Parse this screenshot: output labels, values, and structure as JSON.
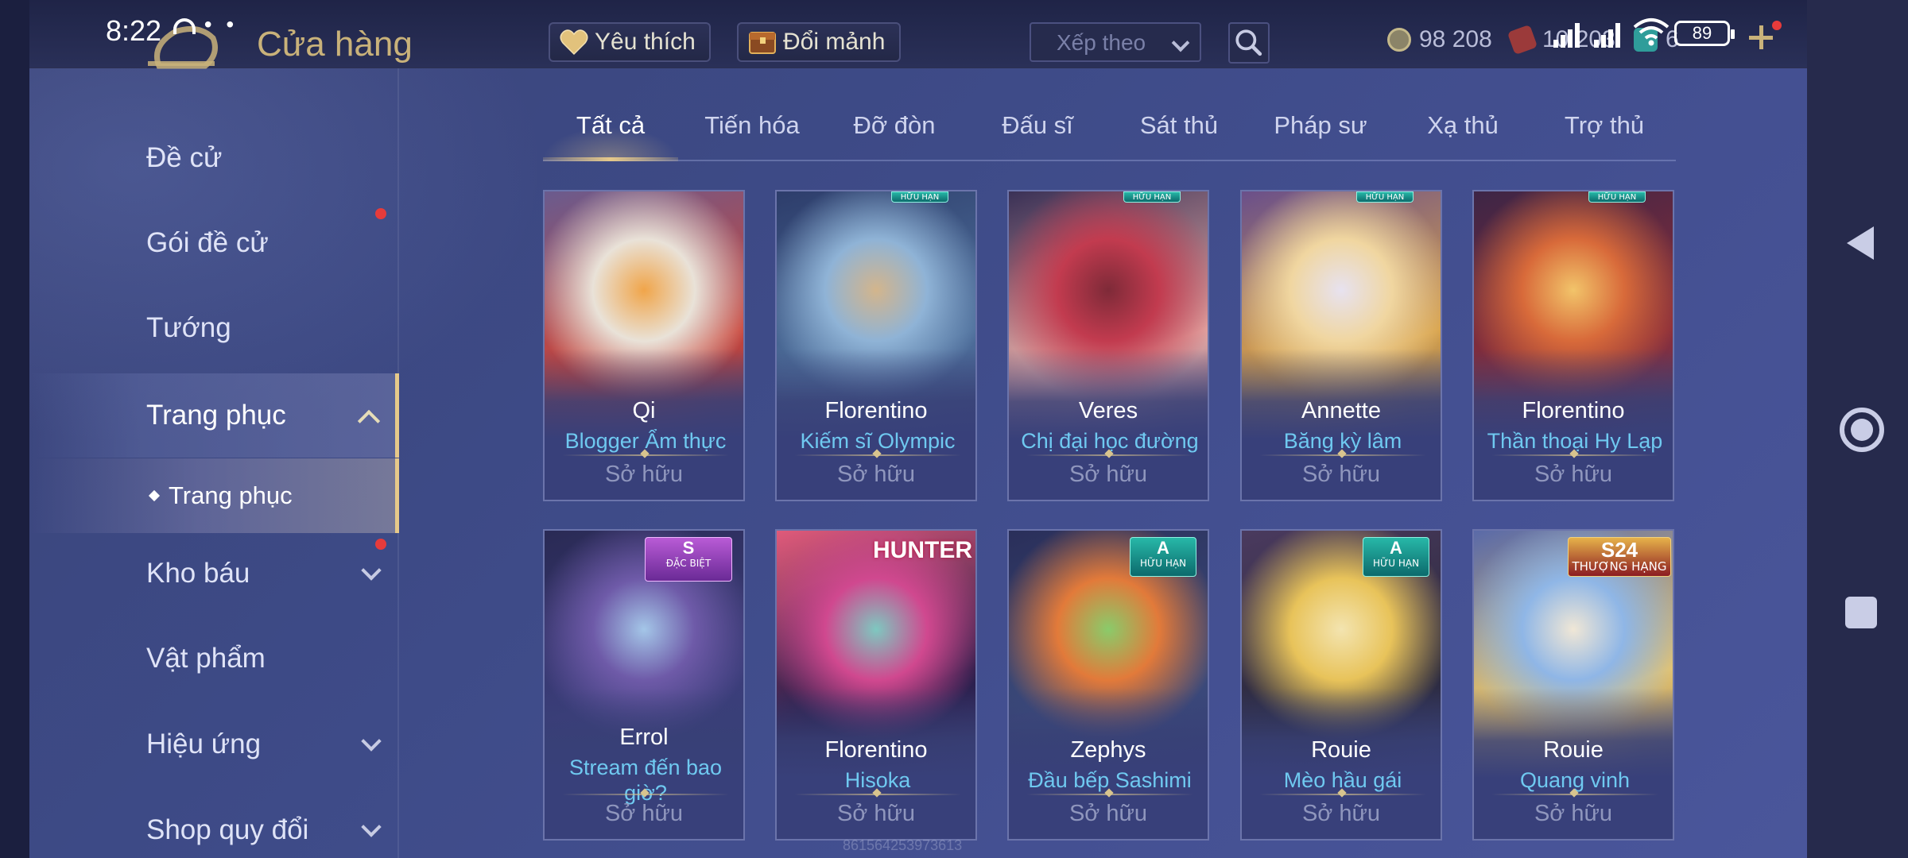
{
  "status": {
    "time": "8:22",
    "battery": "89"
  },
  "header": {
    "title": "Cửa hàng",
    "favorites_label": "Yêu thích",
    "shard_exchange_label": "Đổi mảnh",
    "sort_placeholder": "Xếp theo",
    "currency_gold": "98 208",
    "currency_red": "10 203",
    "currency_blue": "6"
  },
  "sidebar": {
    "items": [
      {
        "label": "Đề cử",
        "has_dot": false,
        "chevron": "none"
      },
      {
        "label": "Gói đề cử",
        "has_dot": true,
        "chevron": "none"
      },
      {
        "label": "Tướng",
        "has_dot": false,
        "chevron": "none"
      },
      {
        "label": "Trang phục",
        "has_dot": false,
        "chevron": "up",
        "active": true
      },
      {
        "label": "Kho báu",
        "has_dot": true,
        "chevron": "down"
      },
      {
        "label": "Vật phẩm",
        "has_dot": false,
        "chevron": "none"
      },
      {
        "label": "Hiệu ứng",
        "has_dot": false,
        "chevron": "down"
      },
      {
        "label": "Shop quy đổi",
        "has_dot": false,
        "chevron": "down"
      }
    ],
    "subitem": "Trang phục"
  },
  "tabs": [
    "Tất cả",
    "Tiến hóa",
    "Đỡ đòn",
    "Đấu sĩ",
    "Sát thủ",
    "Pháp sư",
    "Xạ thủ",
    "Trợ thủ"
  ],
  "cards": [
    {
      "hero": "Qi",
      "skin": "Blogger Ẩm thực",
      "status": "Sở hữu",
      "tag": ""
    },
    {
      "hero": "Florentino",
      "skin": "Kiếm sĩ Olympic",
      "status": "Sở hữu",
      "tag": "HỮU HẠN"
    },
    {
      "hero": "Veres",
      "skin": "Chị đại học đường",
      "status": "Sở hữu",
      "tag": "HỮU HẠN"
    },
    {
      "hero": "Annette",
      "skin": "Băng kỳ lâm",
      "status": "Sở hữu",
      "tag": "HỮU HẠN"
    },
    {
      "hero": "Florentino",
      "skin": "Thần thoại Hy Lạp",
      "status": "Sở hữu",
      "tag": "HỮU HẠN"
    },
    {
      "hero": "Errol",
      "skin": "Stream đến bao giờ?",
      "status": "Sở hữu",
      "tag_grade": "S",
      "tag": "ĐẶC BIỆT"
    },
    {
      "hero": "Florentino",
      "skin": "Hisoka",
      "status": "Sở hữu",
      "tag": "HUNTER"
    },
    {
      "hero": "Zephys",
      "skin": "Đầu bếp Sashimi",
      "status": "Sở hữu",
      "tag_grade": "A",
      "tag": "HỮU HẠN"
    },
    {
      "hero": "Rouie",
      "skin": "Mèo hầu gái",
      "status": "Sở hữu",
      "tag_grade": "A",
      "tag": "HỮU HẠN"
    },
    {
      "hero": "Rouie",
      "skin": "Quang vinh",
      "status": "Sở hữu",
      "tag_grade": "S24",
      "tag": "THƯỢNG HẠNG"
    }
  ],
  "watermark": "861564253973613",
  "colors": {
    "accent_gold": "#e6c98a",
    "skin_name_blue": "#6fc9f0",
    "notification_red": "#e63b3b"
  }
}
